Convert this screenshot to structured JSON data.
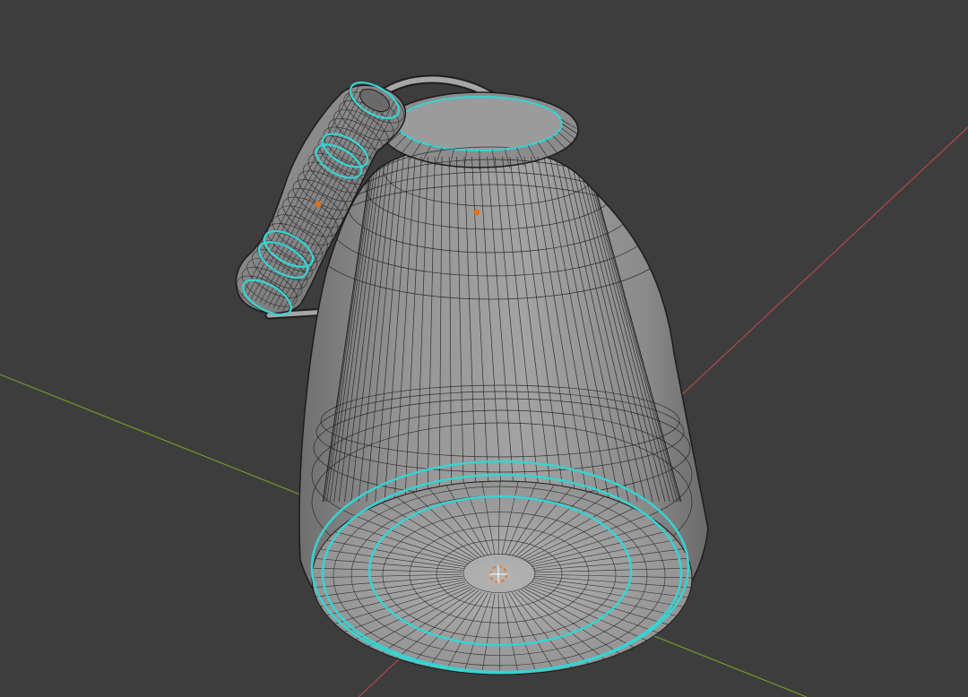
{
  "viewport": {
    "background_color": "#3d3d3d",
    "x_axis_color": "#b5474b",
    "y_axis_color": "#6e9a2b",
    "mesh_fill_color": "#8f8f8f",
    "wire_color": "#1c1c1c",
    "seam_color": "#35d4d4",
    "origin_dot_color": "#e0701a",
    "cursor_color": "#e87a2a",
    "objects": [
      "milk-can-body",
      "milk-can-handle-grip",
      "milk-can-bail-wire"
    ],
    "origin_points": [
      "body-origin",
      "grip-origin"
    ]
  }
}
